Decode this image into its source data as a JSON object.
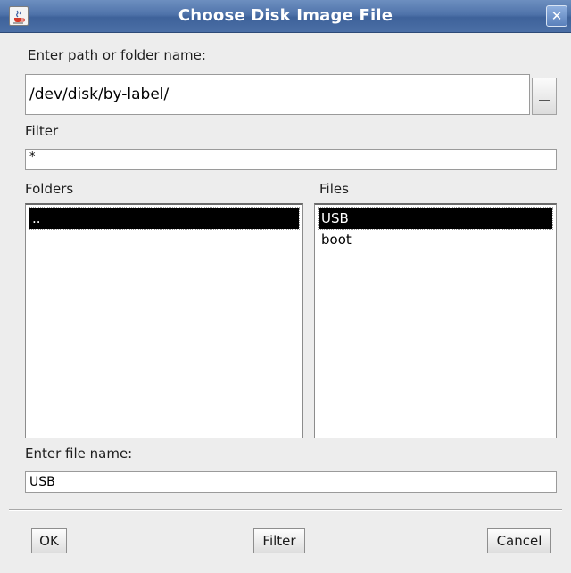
{
  "window": {
    "title": "Choose Disk Image File",
    "close_glyph": "✕"
  },
  "path": {
    "label": "Enter path or folder name:",
    "value": "/dev/disk/by-label/"
  },
  "filter": {
    "label": "Filter",
    "value": "*"
  },
  "folders": {
    "label": "Folders",
    "items": [
      ".."
    ],
    "selected_index": 0
  },
  "files": {
    "label": "Files",
    "items": [
      "USB",
      "boot"
    ],
    "selected_index": 0
  },
  "filename": {
    "label": "Enter file name:",
    "value": "USB"
  },
  "buttons": {
    "ok": "OK",
    "filter": "Filter",
    "cancel": "Cancel"
  },
  "colors": {
    "titlebar": "#4f73aa",
    "selection": "#000000",
    "dialog_bg": "#ededed"
  },
  "icons": {
    "app": "java-cup-icon",
    "close": "close-icon",
    "browse": "ellipsis-icon"
  }
}
